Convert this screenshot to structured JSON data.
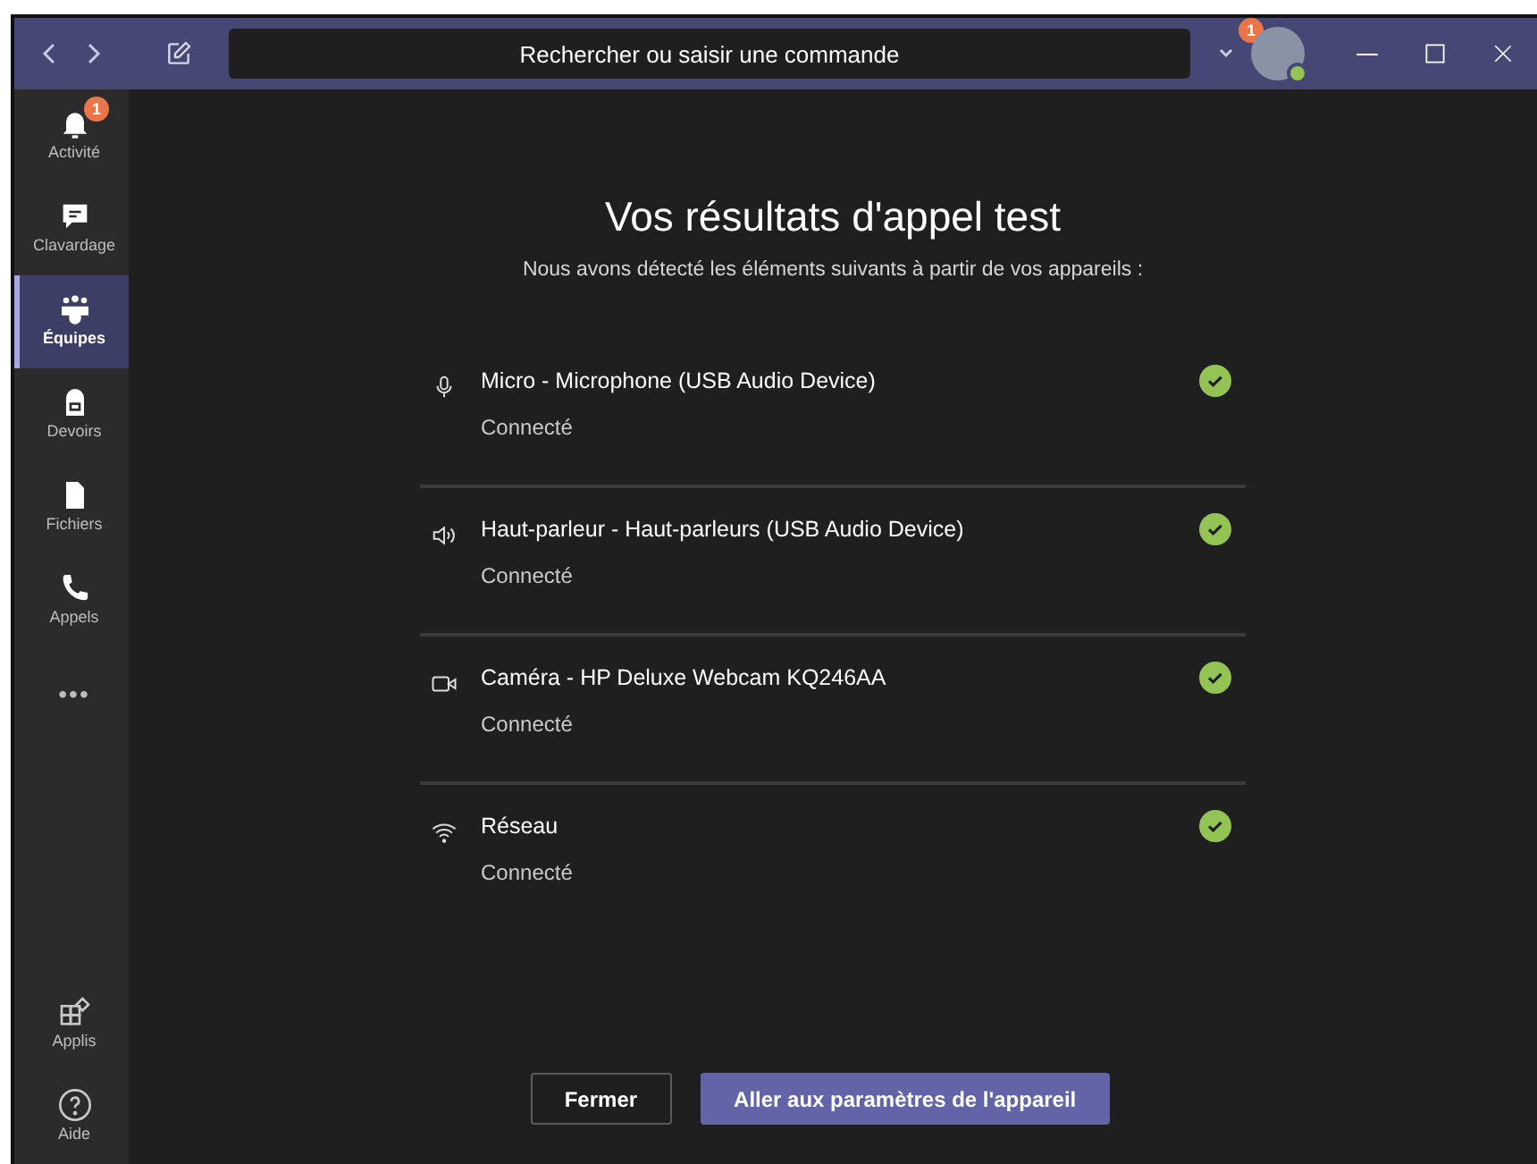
{
  "title_bar": {
    "search": {
      "placeholder": "Rechercher ou saisir une commande"
    },
    "notification_badge": "1"
  },
  "sidebar": {
    "items": [
      {
        "label": "Activité",
        "badge": "1",
        "selected": false
      },
      {
        "label": "Clavardage",
        "selected": false
      },
      {
        "label": "Équipes",
        "selected": true
      },
      {
        "label": "Devoirs",
        "selected": false
      },
      {
        "label": "Fichiers",
        "selected": false
      },
      {
        "label": "Appels",
        "selected": false
      },
      {
        "label": "•••",
        "selected": false
      }
    ],
    "bottom_items": [
      {
        "label": "Applis",
        "selected": false
      },
      {
        "label": "Aide",
        "selected": false
      }
    ]
  },
  "dialog": {
    "title": "Vos résultats d'appel test",
    "subtitle": "Nous avons détecté les éléments suivants à partir de vos appareils :",
    "devices": [
      {
        "kind": "microphone",
        "name": "Micro - Microphone (USB Audio Device)",
        "status": "Connecté",
        "ok": true
      },
      {
        "kind": "speaker",
        "name": "Haut-parleur - Haut-parleurs (USB Audio Device)",
        "status": "Connecté",
        "ok": true
      },
      {
        "kind": "camera",
        "name": "Caméra - HP Deluxe Webcam KQ246AA",
        "status": "Connecté",
        "ok": true
      },
      {
        "kind": "network",
        "name": "Réseau",
        "status": "Connecté",
        "ok": true
      }
    ],
    "buttons": [
      {
        "label": "Fermer",
        "kind": "secondary"
      },
      {
        "label": "Aller aux paramètres de l'appareil",
        "kind": "primary"
      }
    ]
  }
}
